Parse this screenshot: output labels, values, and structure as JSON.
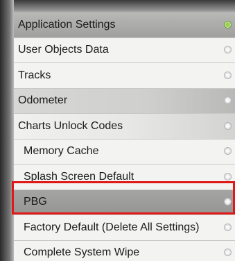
{
  "menu": {
    "items": [
      {
        "label": "Application Settings",
        "selected": true
      },
      {
        "label": "User Objects Data",
        "selected": false
      },
      {
        "label": "Tracks",
        "selected": false
      },
      {
        "label": "Odometer",
        "selected": false
      },
      {
        "label": "Charts Unlock Codes",
        "selected": false
      },
      {
        "label": "Memory Cache",
        "selected": false
      },
      {
        "label": "Splash Screen Default",
        "selected": false
      },
      {
        "label": "PBG",
        "selected": false,
        "highlighted": true
      },
      {
        "label": "Factory Default (Delete All Settings)",
        "selected": false
      },
      {
        "label": "Complete System Wipe",
        "selected": false
      }
    ]
  },
  "colors": {
    "highlight_border": "#e01818",
    "selected_radio": "#9bd04f"
  }
}
